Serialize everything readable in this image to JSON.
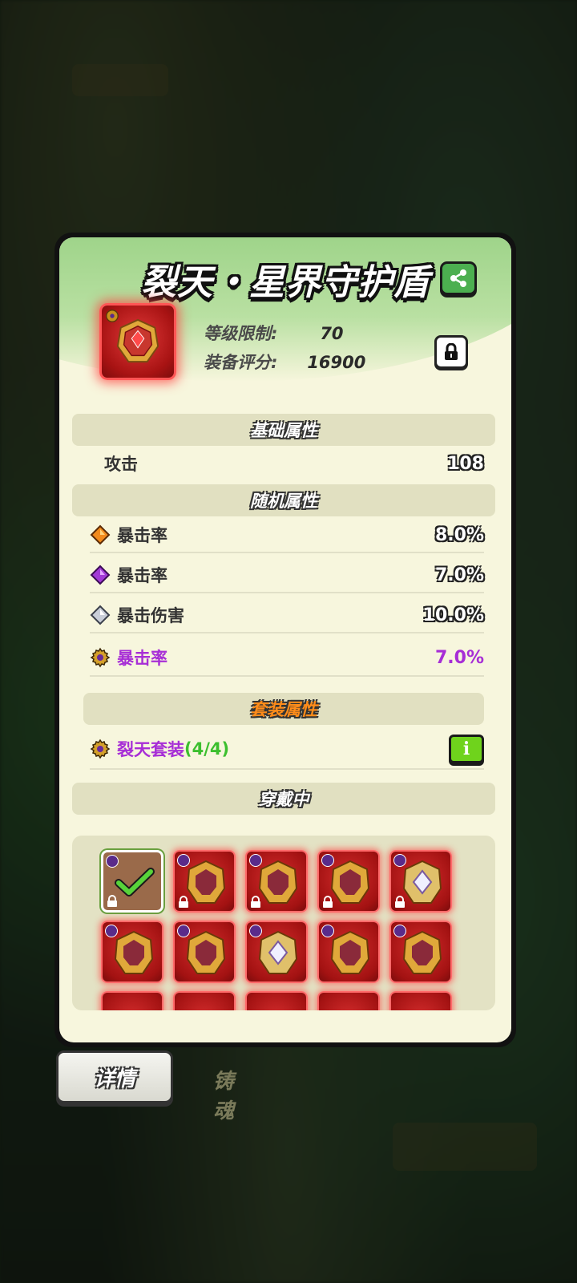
{
  "item": {
    "title": "裂天・星界守护盾",
    "level_label": "等级限制:",
    "level_value": "70",
    "score_label": "装备评分:",
    "score_value": "16900"
  },
  "sections": {
    "base": "基础属性",
    "random": "随机属性",
    "set": "套装属性",
    "wearing": "穿戴中"
  },
  "base_stats": [
    {
      "label": "攻击",
      "value": "108"
    }
  ],
  "random_stats": [
    {
      "icon": "orange-gem-icon",
      "label": "暴击率",
      "value": "8.0%"
    },
    {
      "icon": "purple-gem-icon",
      "label": "暴击率",
      "value": "7.0%"
    },
    {
      "icon": "silver-gem-icon",
      "label": "暴击伤害",
      "value": "10.0%"
    },
    {
      "icon": "gear-icon",
      "label": "暴击率",
      "value": "7.0%"
    }
  ],
  "set_bonus": {
    "name": "裂天套装",
    "count": "(4/4)",
    "info": "i"
  },
  "tabs": {
    "details": "详情",
    "forge": "铸魂"
  },
  "colors": {
    "accent_purple": "#a72ed6",
    "accent_green": "#3cbf2e",
    "rarity_red": "#d42d2d"
  }
}
